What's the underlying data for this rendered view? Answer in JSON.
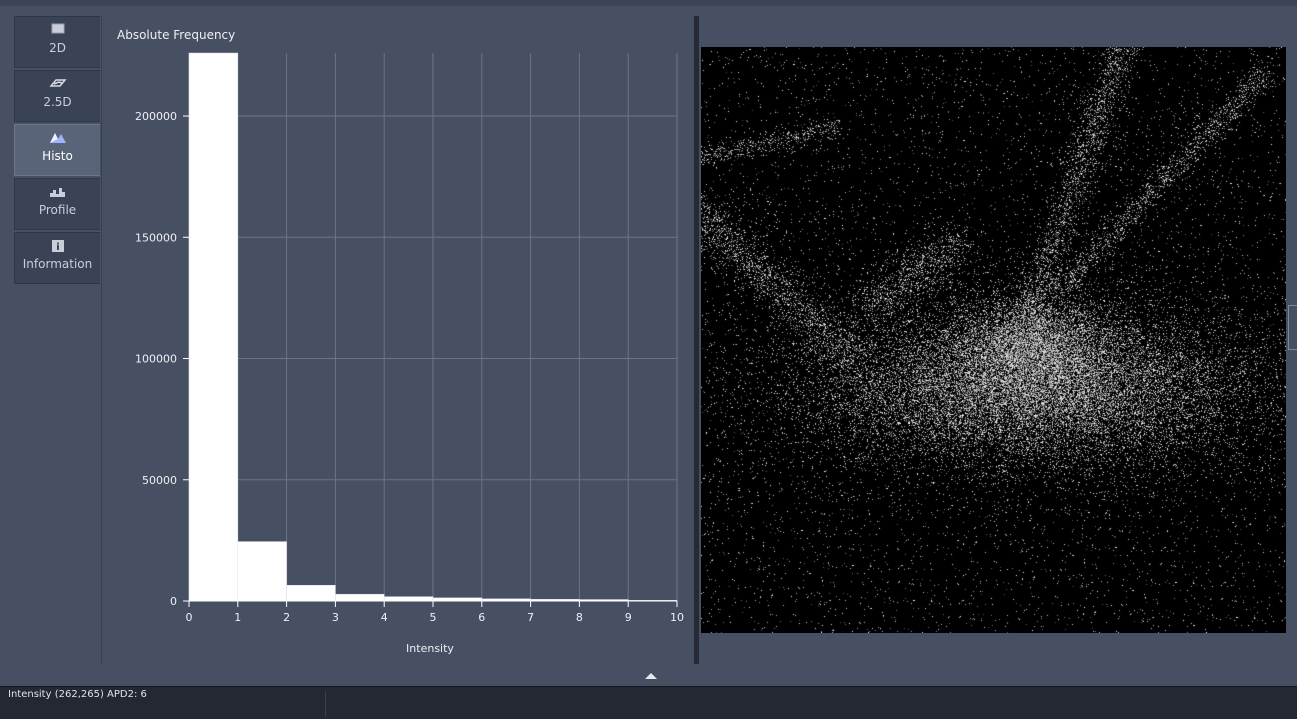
{
  "tabs": [
    {
      "label": "2D",
      "icon": "rectangle-icon",
      "active": false
    },
    {
      "label": "2.5D",
      "icon": "perspective-icon",
      "active": false
    },
    {
      "label": "Histo",
      "icon": "histogram-icon",
      "active": true
    },
    {
      "label": "Profile",
      "icon": "profile-icon",
      "active": false
    },
    {
      "label": "Information",
      "icon": "info-icon",
      "active": false
    }
  ],
  "chart_data": {
    "type": "bar",
    "title": "Absolute Frequency",
    "xlabel": "Intensity",
    "ylabel": "Absolute Frequency",
    "x_bins": [
      [
        0,
        1
      ],
      [
        1,
        2
      ],
      [
        2,
        3
      ],
      [
        3,
        4
      ],
      [
        4,
        5
      ],
      [
        5,
        6
      ],
      [
        6,
        7
      ],
      [
        7,
        8
      ],
      [
        8,
        9
      ],
      [
        9,
        10
      ]
    ],
    "values": [
      226000,
      24500,
      6500,
      2800,
      1800,
      1300,
      900,
      700,
      600,
      300
    ],
    "xlim": [
      0,
      10
    ],
    "ylim": [
      0,
      226000
    ],
    "xticks": [
      0,
      1,
      2,
      3,
      4,
      5,
      6,
      7,
      8,
      9,
      10
    ],
    "yticks": [
      0,
      50000,
      100000,
      150000,
      200000
    ],
    "grid": true,
    "bar_color": "#ffffff",
    "grid_color": "#6b748a"
  },
  "status": {
    "text": "Intensity (262,265) APD2: 6"
  },
  "colors": {
    "background": "#474f63",
    "image_background": "#000000"
  }
}
